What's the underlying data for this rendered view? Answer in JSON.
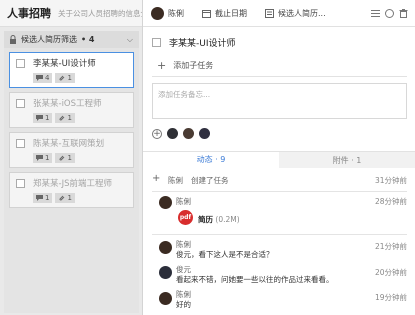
{
  "app": {
    "title": "人事招聘",
    "description": "关于公司人员招聘的信息全流"
  },
  "column": {
    "name": "候选人简历筛选",
    "count": "• 4"
  },
  "cards": [
    {
      "name": "李某某-UI设计师",
      "comments": "4",
      "attachments": "1",
      "active": true
    },
    {
      "name": "张某某-iOS工程师",
      "comments": "1",
      "attachments": "1"
    },
    {
      "name": "陈某某-互联网策划",
      "comments": "1",
      "attachments": "1"
    },
    {
      "name": "郑某某-JS前端工程师",
      "comments": "1",
      "attachments": "1"
    }
  ],
  "topbar": {
    "owner": "陈俐",
    "due_label": "截止日期",
    "list_label": "候选人简历..."
  },
  "task": {
    "title": "李某某-UI设计师",
    "add_subtask": "添加子任务",
    "note_placeholder": "添加任务备忘..."
  },
  "tabs": {
    "activity": "动态 · 9",
    "attachments": "附件 · 1"
  },
  "activity": [
    {
      "type": "log",
      "user": "陈俐",
      "action": "创建了任务",
      "time": "31分钟前"
    },
    {
      "type": "file",
      "user": "陈俐",
      "file_icon": "pdf",
      "file_name": "简历",
      "file_size": "(0.2M)",
      "time": "28分钟前"
    },
    {
      "type": "comment",
      "user": "陈俐",
      "text": "俊元，看下这人是不是合适？",
      "time": "21分钟前"
    },
    {
      "type": "comment",
      "user": "俊元",
      "text": "看起来不错，问她要一些以往的作品过来看看。",
      "time": "20分钟前"
    },
    {
      "type": "comment",
      "user": "陈俐",
      "text": "好的",
      "time": "19分钟前"
    }
  ]
}
